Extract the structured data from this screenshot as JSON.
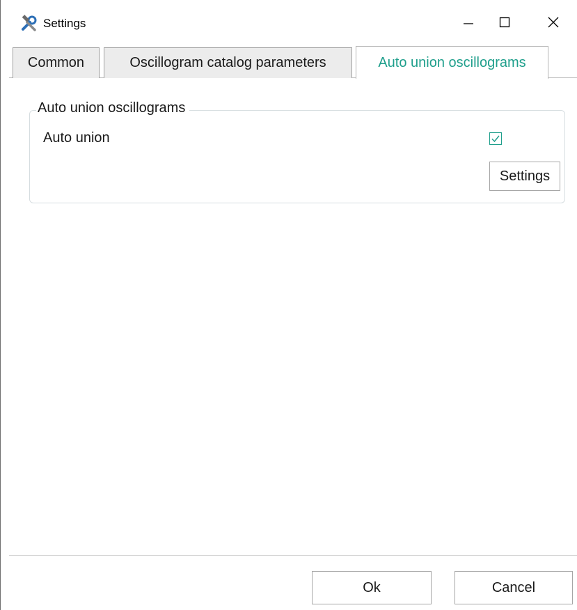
{
  "window": {
    "title": "Settings",
    "icon": "tools-icon",
    "controls": {
      "minimize": "minimize-icon",
      "maximize": "maximize-icon",
      "close": "close-icon"
    }
  },
  "tabs": [
    {
      "label": "Common",
      "active": false
    },
    {
      "label": "Oscillogram catalog parameters",
      "active": false
    },
    {
      "label": "Auto union oscillograms",
      "active": true
    }
  ],
  "group": {
    "title": "Auto union oscillograms",
    "auto_union_label": "Auto union",
    "auto_union_checked": true,
    "settings_button": "Settings"
  },
  "footer": {
    "ok_label": "Ok",
    "cancel_label": "Cancel"
  },
  "colors": {
    "accent": "#1f9f8c",
    "border": "#a0a0a0"
  }
}
